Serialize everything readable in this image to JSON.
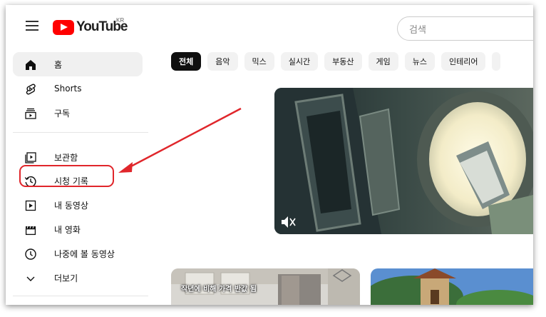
{
  "header": {
    "logo_text": "YouTube",
    "logo_region": "KR",
    "search_placeholder": "검색"
  },
  "sidebar": {
    "items": [
      {
        "label": "홈",
        "icon": "home-icon",
        "active": true
      },
      {
        "label": "Shorts",
        "icon": "shorts-icon"
      },
      {
        "label": "구독",
        "icon": "subscriptions-icon"
      },
      {
        "label": "보관함",
        "icon": "library-icon"
      },
      {
        "label": "시청 기록",
        "icon": "history-icon",
        "highlighted": true
      },
      {
        "label": "내 동영상",
        "icon": "your-videos-icon"
      },
      {
        "label": "내 영화",
        "icon": "movies-icon"
      },
      {
        "label": "나중에 볼 동영상",
        "icon": "watch-later-icon"
      },
      {
        "label": "더보기",
        "icon": "chevron-down-icon"
      }
    ]
  },
  "chips": [
    "전체",
    "음악",
    "믹스",
    "실시간",
    "부동산",
    "게임",
    "뉴스",
    "인테리어"
  ],
  "feed": {
    "bottom_thumb_caption": "작년에 비해 가격 반값 됨"
  },
  "colors": {
    "brand_red": "#ff0000",
    "annotation_red": "#e0262b",
    "active_chip": "#0f0f0f",
    "chip_bg": "#f2f2f2"
  }
}
